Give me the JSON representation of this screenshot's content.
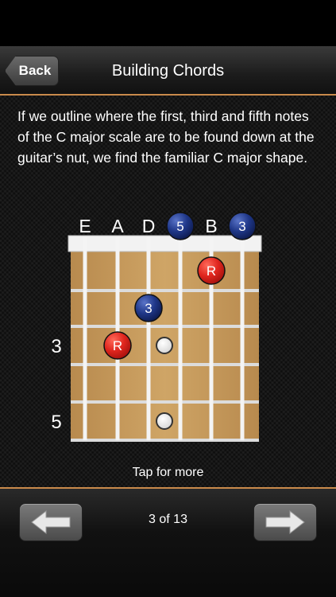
{
  "nav": {
    "back_label": "Back",
    "title": "Building Chords"
  },
  "content": {
    "intro": "If we outline where the first, third and fifth notes of the C major scale are to be found down at the guitar’s nut, we find the familiar C major shape.",
    "tap_for_more": "Tap for more"
  },
  "fretboard": {
    "open_string_labels": [
      "E",
      "A",
      "D",
      "",
      "B",
      ""
    ],
    "fret_markers": [
      {
        "fret": 3,
        "label": "3"
      },
      {
        "fret": 5,
        "label": "5"
      }
    ],
    "open_notes": [
      {
        "string": 3,
        "label": "5",
        "color": "#1a2f7a"
      },
      {
        "string": 5,
        "label": "3",
        "color": "#1a2f7a"
      }
    ],
    "fretted_notes": [
      {
        "string": 4,
        "fret": 1,
        "label": "R",
        "color": "#d61f1f"
      },
      {
        "string": 2,
        "fret": 2,
        "label": "3",
        "color": "#1a2f7a"
      },
      {
        "string": 1,
        "fret": 3,
        "label": "R",
        "color": "#d61f1f"
      }
    ],
    "inlays": [
      3,
      5
    ],
    "colors": {
      "wood": "#c49a5c",
      "root": "#d61f1f",
      "interval": "#1a2f7a"
    }
  },
  "footer": {
    "page_indicator": "3 of 13",
    "prev_icon": "left-arrow-icon",
    "next_icon": "right-arrow-icon"
  }
}
